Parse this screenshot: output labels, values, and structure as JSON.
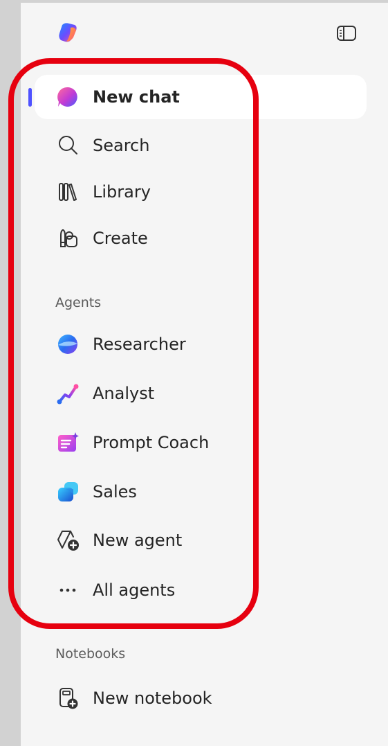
{
  "nav": {
    "new_chat": "New chat",
    "search": "Search",
    "library": "Library",
    "create": "Create"
  },
  "agents": {
    "heading": "Agents",
    "researcher": "Researcher",
    "analyst": "Analyst",
    "prompt_coach": "Prompt Coach",
    "sales": "Sales",
    "new_agent": "New agent",
    "all_agents": "All agents"
  },
  "notebooks": {
    "heading": "Notebooks",
    "new_notebook": "New notebook"
  },
  "colors": {
    "active_indicator": "#4f52ff",
    "highlight_outline": "#e6000f",
    "panel_bg": "#f5f5f5"
  }
}
